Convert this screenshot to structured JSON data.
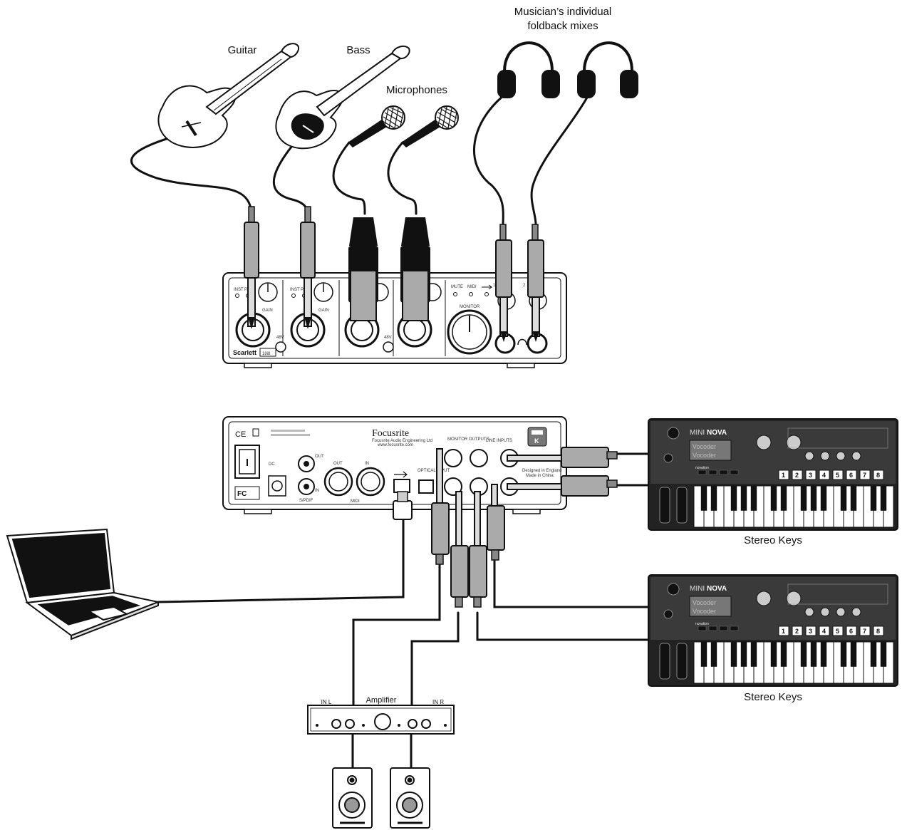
{
  "labels": {
    "foldback_line1": "Musician’s individual",
    "foldback_line2": "foldback mixes",
    "guitar": "Guitar",
    "bass": "Bass",
    "microphones": "Microphones",
    "stereo_keys_1": "Stereo Keys",
    "stereo_keys_2": "Stereo Keys",
    "amplifier": "Amplifier",
    "amp_in_l": "IN L",
    "amp_in_r": "IN R"
  },
  "front_panel": {
    "brand": "Scarlett",
    "model": "18i8",
    "inst_1": "INST",
    "pad_1": "PAD",
    "inst_2": "INST",
    "pad_2": "PAD",
    "gain": "GAIN",
    "phantom_1": "48V",
    "phantom_2": "48V",
    "mute": "MUTE",
    "midi": "MIDI",
    "monitor": "MONITOR",
    "hp_1": "1",
    "hp_2": "2"
  },
  "rear_panel": {
    "brand": "Focusrite",
    "brand_sub": "Focusrite Audio Engineering Ltd",
    "brand_url": "www.focusrite.com",
    "ce_mark": "CE",
    "fc_mark": "FC",
    "midi_out": "OUT",
    "midi_in": "IN",
    "midi": "MIDI",
    "spdif_out": "OUT",
    "spdif_in": "IN",
    "spdif": "S/PDIF",
    "optical": "OPTICAL INPUT",
    "monitor_outputs": "MONITOR OUTPUTS",
    "line_inputs": "LINE INPUTS",
    "designed": "Designed in England",
    "made": "Made in China",
    "power": "DC",
    "k_badge": "K"
  },
  "synth": {
    "brand_thin": "MINI",
    "brand_bold": "NOVA",
    "screen_line1": "Vocoder",
    "screen_line2": "Vocoder",
    "maker": "novation",
    "pads": [
      "1",
      "2",
      "3",
      "4",
      "5",
      "6",
      "7",
      "8"
    ]
  },
  "icons": {
    "headphone": "headphones-icon",
    "usb": "usb-icon",
    "guitar": "electric-guitar-icon",
    "bass": "bass-guitar-icon",
    "microphone": "microphone-icon",
    "laptop": "laptop-icon",
    "speaker": "speaker-icon"
  }
}
